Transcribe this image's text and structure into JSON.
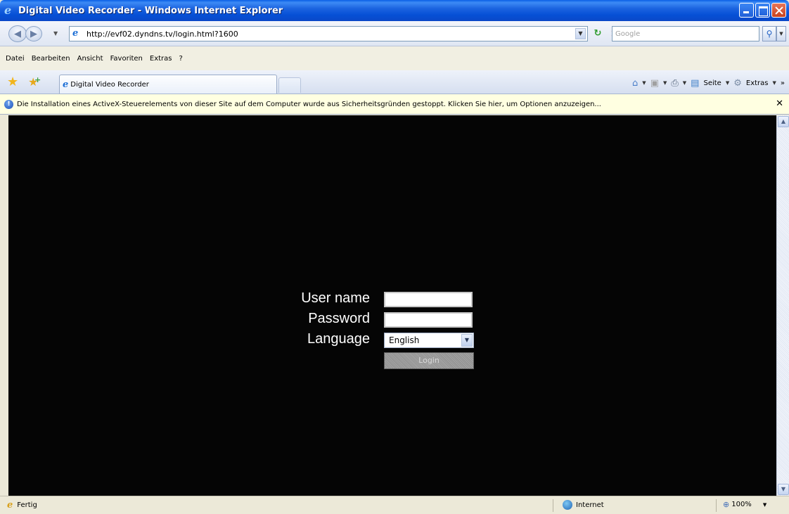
{
  "window": {
    "title": "Digital Video Recorder - Windows Internet Explorer"
  },
  "address": {
    "url": "http://evf02.dyndns.tv/login.html?1600",
    "search_placeholder": "Google"
  },
  "menu": [
    {
      "label": "Datei"
    },
    {
      "label": "Bearbeiten"
    },
    {
      "label": "Ansicht"
    },
    {
      "label": "Favoriten"
    },
    {
      "label": "Extras"
    },
    {
      "label": "?"
    }
  ],
  "tabs": {
    "active_label": "Digital Video Recorder"
  },
  "toolbar": {
    "page_label": "Seite",
    "tools_label": "Extras",
    "overflow": "»"
  },
  "infobar": {
    "message": "Die Installation eines ActiveX-Steuerelements von dieser Site auf dem Computer wurde aus Sicherheitsgründen gestoppt. Klicken Sie hier, um Optionen anzuzeigen..."
  },
  "login": {
    "username_label": "User name",
    "username_value": "",
    "password_label": "Password",
    "password_value": "",
    "language_label": "Language",
    "language_selected": "English",
    "login_button": "Login"
  },
  "status": {
    "text": "Fertig",
    "zone": "Internet",
    "zoom": "100%"
  },
  "colors": {
    "content_background": "#050505",
    "label_text": "#ffffff",
    "titlebar": "#0a5fe6",
    "infobar": "#ffffe1"
  }
}
